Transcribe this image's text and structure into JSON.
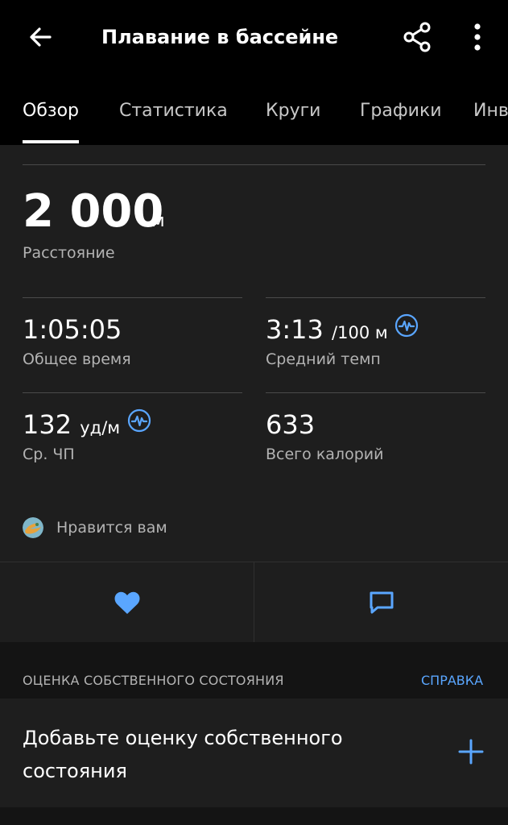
{
  "header": {
    "title": "Плавание в бассейне",
    "back_icon": "arrow-left-icon",
    "share_icon": "share-icon",
    "more_icon": "more-vertical-icon"
  },
  "tabs": [
    {
      "label": "Обзор",
      "active": true
    },
    {
      "label": "Статистика",
      "active": false
    },
    {
      "label": "Круги",
      "active": false
    },
    {
      "label": "Графики",
      "active": false
    },
    {
      "label": "Инв",
      "active": false
    }
  ],
  "summary": {
    "distance": {
      "value": "2 000",
      "unit": "м",
      "label": "Расстояние"
    },
    "total_time": {
      "value": "1:05:05",
      "label": "Общее время"
    },
    "avg_pace": {
      "value": "3:13",
      "unit": "/100 м",
      "label": "Средний темп"
    },
    "avg_hr": {
      "value": "132",
      "unit": "уд/м",
      "label": "Ср. ЧП"
    },
    "calories": {
      "value": "633",
      "label": "Всего калорий"
    }
  },
  "likes": {
    "text": "Нравится вам"
  },
  "actions": {
    "like_icon": "heart-icon",
    "comment_icon": "comment-icon"
  },
  "self_evaluation": {
    "section_title": "ОЦЕНКА СОБСТВЕННОГО СОСТОЯНИЯ",
    "help_link": "СПРАВКА",
    "add_text": "Добавьте оценку собственного состояния",
    "add_icon": "plus-icon"
  },
  "colors": {
    "accent": "#5aa6ff",
    "background": "#1e1e1e",
    "appbar": "#000000"
  }
}
